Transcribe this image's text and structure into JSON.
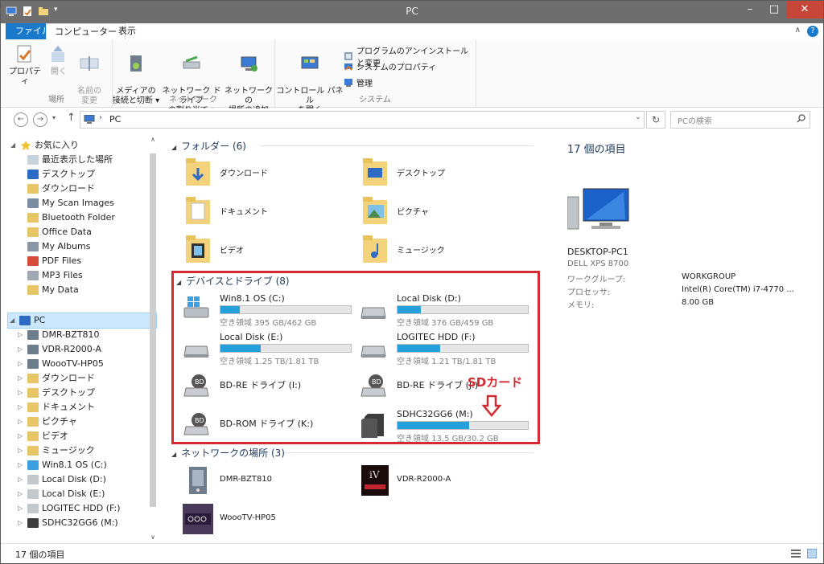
{
  "window": {
    "title": "PC"
  },
  "ribbon_tabs": [
    {
      "label": "ファイル"
    },
    {
      "label": "コンピューター"
    },
    {
      "label": "表示"
    }
  ],
  "ribbon": {
    "groups": {
      "location": "場所",
      "network": "ネットワーク",
      "system": "システム"
    },
    "buttons": {
      "properties": "プロパティ",
      "open": "開く",
      "rename": "名前の\n変更",
      "access_media": "メディアの\n接続と切断 ▾",
      "map_drive": "ネットワーク ドライブ\nの割り当て ▾",
      "add_network_location": "ネットワークの\n場所の追加",
      "control_panel": "コントロール パネル\nを開く",
      "uninstall": "プログラムのアンインストールと変更",
      "system_properties": "システムのプロパティ",
      "manage": "管理"
    }
  },
  "address": {
    "path": "PC",
    "search_placeholder": "PCの検索"
  },
  "navpane": {
    "favorites_label": "お気に入り",
    "favorites": [
      {
        "label": "最近表示した場所"
      },
      {
        "label": "デスクトップ"
      },
      {
        "label": "ダウンロード"
      },
      {
        "label": "My Scan Images"
      },
      {
        "label": "Bluetooth Folder"
      },
      {
        "label": "Office Data"
      },
      {
        "label": "My Albums"
      },
      {
        "label": "PDF Files"
      },
      {
        "label": "MP3 Files"
      },
      {
        "label": "My Data"
      }
    ],
    "pc_label": "PC",
    "pc_children": [
      {
        "label": "DMR-BZT810"
      },
      {
        "label": "VDR-R2000-A"
      },
      {
        "label": "WoooTV-HP05"
      },
      {
        "label": "ダウンロード"
      },
      {
        "label": "デスクトップ"
      },
      {
        "label": "ドキュメント"
      },
      {
        "label": "ピクチャ"
      },
      {
        "label": "ビデオ"
      },
      {
        "label": "ミュージック"
      },
      {
        "label": "Win8.1 OS (C:)"
      },
      {
        "label": "Local Disk (D:)"
      },
      {
        "label": "Local Disk (E:)"
      },
      {
        "label": "LOGITEC HDD (F:)"
      },
      {
        "label": "SDHC32GG6 (M:)"
      }
    ]
  },
  "folders": {
    "header": "フォルダー (6)",
    "items": [
      {
        "label": "ダウンロード"
      },
      {
        "label": "デスクトップ"
      },
      {
        "label": "ドキュメント"
      },
      {
        "label": "ピクチャ"
      },
      {
        "label": "ビデオ"
      },
      {
        "label": "ミュージック"
      }
    ]
  },
  "devices": {
    "header": "デバイスとドライブ (8)",
    "items": [
      {
        "label": "Win8.1 OS (C:)",
        "size": "空き領域 395 GB/462 GB",
        "used_fraction": 0.15
      },
      {
        "label": "Local Disk (D:)",
        "size": "空き領域 376 GB/459 GB",
        "used_fraction": 0.18
      },
      {
        "label": "Local Disk (E:)",
        "size": "空き領域 1.25 TB/1.81 TB",
        "used_fraction": 0.31
      },
      {
        "label": "LOGITEC HDD (F:)",
        "size": "空き領域 1.21 TB/1.81 TB",
        "used_fraction": 0.33
      },
      {
        "label": "BD-RE ドライブ (I:)"
      },
      {
        "label": "BD-RE ドライブ (J:)"
      },
      {
        "label": "BD-ROM ドライブ (K:)"
      },
      {
        "label": "SDHC32GG6 (M:)",
        "size": "空き領域 13.5 GB/30.2 GB",
        "used_fraction": 0.55
      }
    ],
    "annotation": "SDカード"
  },
  "network": {
    "header": "ネットワークの場所 (3)",
    "items": [
      {
        "label": "DMR-BZT810"
      },
      {
        "label": "VDR-R2000-A"
      },
      {
        "label": "WoooTV-HP05"
      }
    ]
  },
  "details": {
    "count": "17 個の項目",
    "name": "DESKTOP-PC1",
    "model": "DELL XPS 8700",
    "props": [
      {
        "key": "ワークグループ:",
        "value": "WORKGROUP"
      },
      {
        "key": "プロセッサ:",
        "value": "Intel(R) Core(TM) i7-4770 ..."
      },
      {
        "key": "メモリ:",
        "value": "8.00 GB"
      }
    ]
  },
  "status": {
    "text": "17 個の項目"
  },
  "colors": {
    "accent": "#1979ca",
    "annotation": "#d42b32",
    "bar_fill": "#26a0da"
  }
}
